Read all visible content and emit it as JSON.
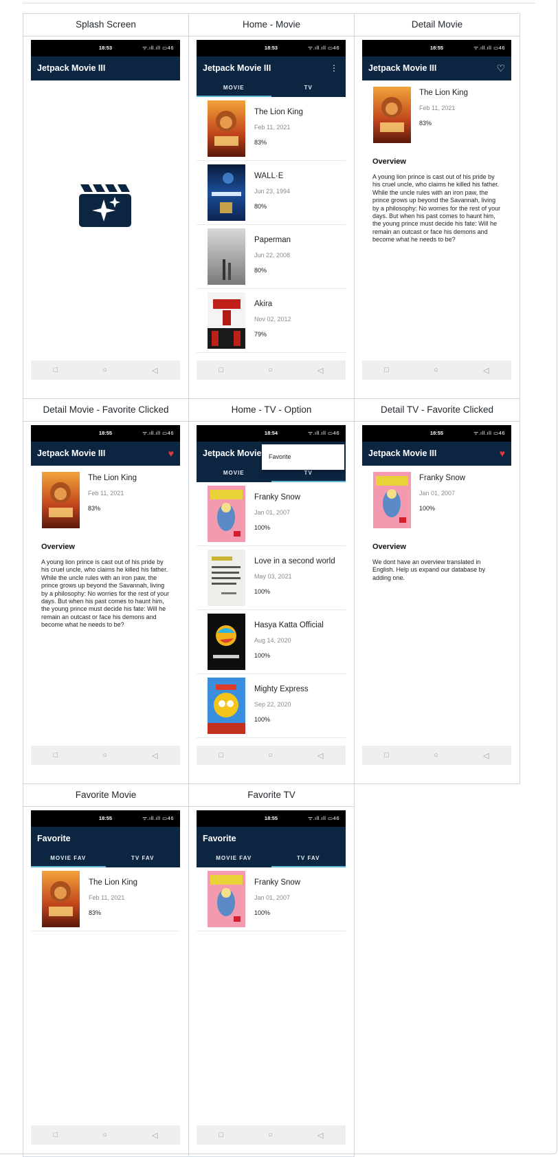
{
  "screens_row1": [
    {
      "caption": "Splash Screen"
    },
    {
      "caption": "Home - Movie"
    },
    {
      "caption": "Detail Movie"
    }
  ],
  "screens_row2": [
    {
      "caption": "Detail Movie - Favorite Clicked"
    },
    {
      "caption": "Home - TV - Option"
    },
    {
      "caption": "Detail TV - Favorite Clicked"
    }
  ],
  "screens_row3": [
    {
      "caption": "Favorite Movie"
    },
    {
      "caption": "Favorite TV"
    }
  ],
  "app": {
    "title": "Jetpack Movie III",
    "favorite_title": "Favorite",
    "tab_movie": "MOVIE",
    "tab_tv": "TV",
    "tab_movie_fav": "MOVIE FAV",
    "tab_tv_fav": "TV FAV",
    "menu_favorite": "Favorite",
    "overview_heading": "Overview",
    "status_signal": "ᯤ.ıll.ıll ▭46",
    "icons": {
      "more": "more-vert-icon",
      "favorite_outline": "heart-outline-icon",
      "favorite_filled": "heart-filled-icon"
    }
  },
  "status_times": {
    "splash": "18:53",
    "home_movie": "18:53",
    "detail_movie": "18:55",
    "detail_fav": "18:55",
    "home_tv": "18:54",
    "detail_tv": "18:55",
    "fav_movie": "18:55",
    "fav_tv": "18:55"
  },
  "movies": [
    {
      "title": "The Lion King",
      "date": "Feb 11, 2021",
      "score": "83%"
    },
    {
      "title": "WALL·E",
      "date": "Jun 23, 1994",
      "score": "80%"
    },
    {
      "title": "Paperman",
      "date": "Jun 22, 2008",
      "score": "80%"
    },
    {
      "title": "Akira",
      "date": "Nov 02, 2012",
      "score": "79%"
    }
  ],
  "tv": [
    {
      "title": "Franky Snow",
      "date": "Jan 01, 2007",
      "score": "100%"
    },
    {
      "title": "Love in a second world",
      "date": "May 03, 2021",
      "score": "100%"
    },
    {
      "title": "Hasya Katta Official",
      "date": "Aug 14, 2020",
      "score": "100%"
    },
    {
      "title": "Mighty Express",
      "date": "Sep 22, 2020",
      "score": "100%"
    }
  ],
  "lion_overview": "A young lion prince is cast out of his pride by his cruel uncle, who claims he killed his father. While the uncle rules with an iron paw, the prince grows up beyond the Savannah, living by a philosophy: No worries for the rest of your days. But when his past comes to haunt him, the young prince must decide his fate: Will he remain an outcast or face his demons and become what he needs to be?",
  "franky_overview": "We dont have an overview translated in English. Help us expand our database by adding one.",
  "colors": {
    "appbar": "#0c2541",
    "tab_indicator": "#62b4d7",
    "favorite": "#e53935"
  }
}
